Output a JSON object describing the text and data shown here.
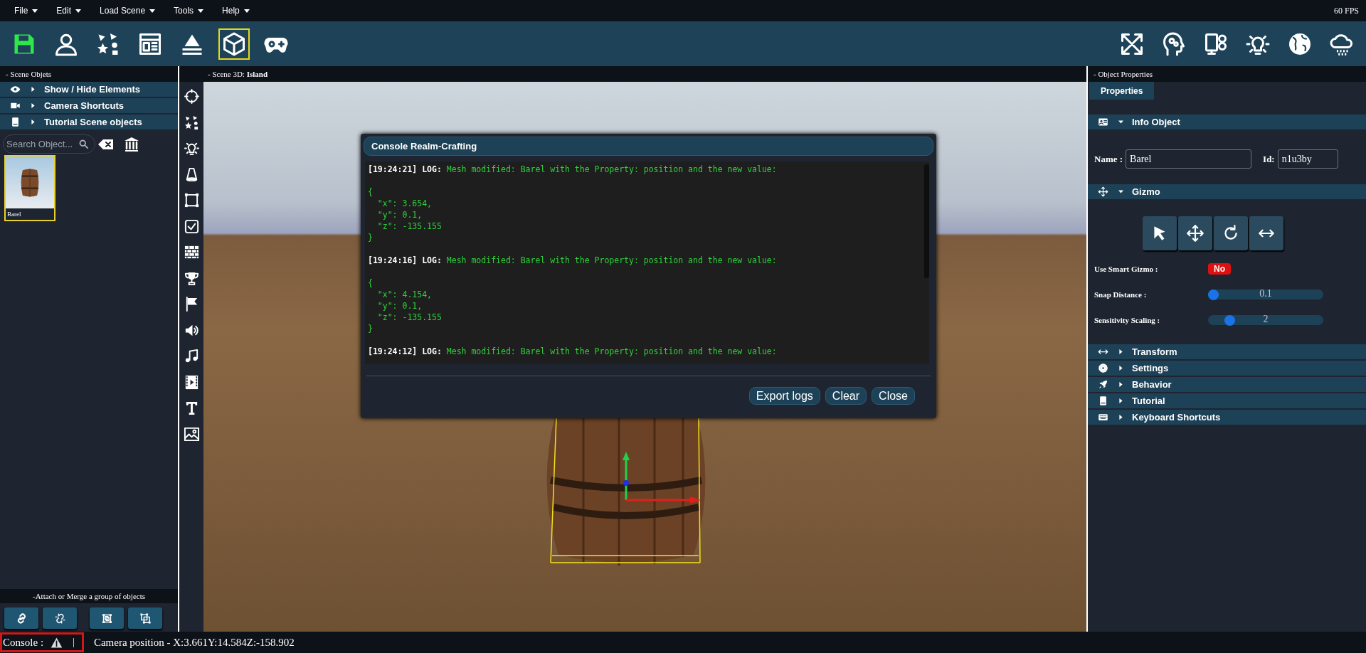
{
  "menu_bar": {
    "items": [
      {
        "label": "File"
      },
      {
        "label": "Edit"
      },
      {
        "label": "Load Scene"
      },
      {
        "label": "Tools"
      },
      {
        "label": "Help"
      }
    ],
    "fps": "60 FPS"
  },
  "toolbar": {
    "left": [
      {
        "kind": "save",
        "selected": false
      },
      {
        "kind": "user",
        "selected": false
      },
      {
        "kind": "shapes",
        "selected": false
      },
      {
        "kind": "layout",
        "selected": false
      },
      {
        "kind": "layers",
        "selected": false
      },
      {
        "kind": "cube",
        "selected": true
      },
      {
        "kind": "gamepad",
        "selected": false
      }
    ],
    "right": [
      {
        "kind": "expand"
      },
      {
        "kind": "head-gears"
      },
      {
        "kind": "devices"
      },
      {
        "kind": "bulb"
      },
      {
        "kind": "globe"
      },
      {
        "kind": "cloud-rain"
      }
    ]
  },
  "scene_objects": {
    "title": "- Scene Objets",
    "sections": [
      {
        "label": "Show / Hide Elements",
        "expanded": false
      },
      {
        "label": "Camera Shortcuts",
        "expanded": false
      },
      {
        "label": "Tutorial Scene objects",
        "expanded": false
      }
    ],
    "search": {
      "placeholder": "Search Object..."
    },
    "objects": [
      {
        "name": "Barel",
        "selected": true
      }
    ],
    "group_title": "-Attach or Merge a group of objects",
    "group_buttons": [
      {
        "kind": "link"
      },
      {
        "kind": "unlink"
      },
      {
        "kind": "group"
      },
      {
        "kind": "ungroup"
      }
    ]
  },
  "tool_strip": [
    {
      "kind": "crosshair"
    },
    {
      "kind": "shapes"
    },
    {
      "kind": "bulb"
    },
    {
      "kind": "cone"
    },
    {
      "kind": "select-box"
    },
    {
      "kind": "checkbox"
    },
    {
      "kind": "bricks"
    },
    {
      "kind": "trophy"
    },
    {
      "kind": "flag"
    },
    {
      "kind": "speaker"
    },
    {
      "kind": "music"
    },
    {
      "kind": "film"
    },
    {
      "kind": "text"
    },
    {
      "kind": "image"
    }
  ],
  "viewport": {
    "title": "- Scene 3D: **Island**"
  },
  "console": {
    "title": "Console Realm-Crafting",
    "entries": [
      {
        "time": "[19:24:21]",
        "level": "LOG:",
        "message": "Mesh modified: Barel with the Property: position and the new value:",
        "value": "{\n  \"x\": 3.654,\n  \"y\": 0.1,\n  \"z\": -135.155\n}"
      },
      {
        "time": "[19:24:16]",
        "level": "LOG:",
        "message": "Mesh modified: Barel with the Property: position and the new value:",
        "value": "{\n  \"x\": 4.154,\n  \"y\": 0.1,\n  \"z\": -135.155\n}"
      },
      {
        "time": "[19:24:12]",
        "level": "LOG:",
        "message": "Mesh modified: Barel with the Property: position and the new value:"
      }
    ],
    "buttons": [
      {
        "label": "Export logs"
      },
      {
        "label": "Clear"
      },
      {
        "label": "Close"
      }
    ]
  },
  "object_properties": {
    "title": "- Object Properties",
    "tabs": [
      {
        "label": "Properties",
        "selected": true
      }
    ],
    "info": {
      "label": "Info Object",
      "expanded": true,
      "name_label": "Name :",
      "name_value": "Barel",
      "id_label": "Id:",
      "id_value": "n1u3by"
    },
    "gizmo": {
      "label": "Gizmo",
      "expanded": true,
      "tools": [
        {
          "kind": "pointer"
        },
        {
          "kind": "move"
        },
        {
          "kind": "rotate"
        },
        {
          "kind": "scale"
        }
      ],
      "smart": {
        "label": "Use Smart Gizmo :",
        "on": false,
        "value": "No"
      },
      "sliders": [
        {
          "label": "Snap Distance :",
          "level": 0.0,
          "reading": "0.1"
        },
        {
          "label": "Sensitivity Scaling :",
          "level": 0.22,
          "reading": "2"
        }
      ]
    },
    "sections": [
      {
        "label": "Transform",
        "expanded": false
      },
      {
        "label": "Settings",
        "expanded": false
      },
      {
        "label": "Behavior",
        "expanded": false
      },
      {
        "label": "Tutorial",
        "expanded": false
      },
      {
        "label": "Keyboard Shortcuts",
        "expanded": false
      }
    ]
  },
  "status_bar": {
    "console_label": "Console :",
    "separator": "|",
    "camera": "Camera position - X:3.661Y:14.584Z:-158.902"
  }
}
